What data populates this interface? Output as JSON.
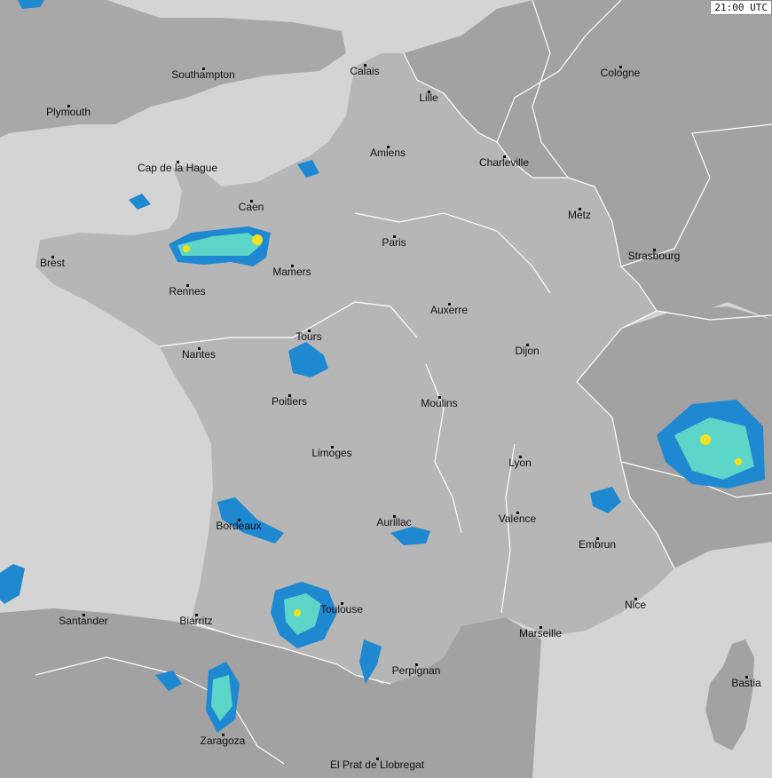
{
  "timestamp": "21:00 UTC",
  "colors": {
    "sea": "#d4d4d4",
    "france": "#b6b6b6",
    "neighbor": "#a2a2a2",
    "uk": "#a8a8a8",
    "border": "#ffffff",
    "rain_low": "#1e88d0",
    "rain_mid": "#5bd6c8",
    "rain_high": "#f5e020"
  },
  "cities": [
    {
      "id": "southampton",
      "name": "Southampton"
    },
    {
      "id": "plymouth",
      "name": "Plymouth"
    },
    {
      "id": "calais",
      "name": "Calais"
    },
    {
      "id": "lille",
      "name": "Lille"
    },
    {
      "id": "cologne",
      "name": "Cologne"
    },
    {
      "id": "amiens",
      "name": "Amiens"
    },
    {
      "id": "charleville",
      "name": "Charleville"
    },
    {
      "id": "cap-de-la-hague",
      "name": "Cap de la Hague"
    },
    {
      "id": "caen",
      "name": "Caen"
    },
    {
      "id": "metz",
      "name": "Metz"
    },
    {
      "id": "paris",
      "name": "Paris"
    },
    {
      "id": "brest",
      "name": "Brest"
    },
    {
      "id": "mamers",
      "name": "Mamers"
    },
    {
      "id": "strasbourg",
      "name": "Strasbourg"
    },
    {
      "id": "rennes",
      "name": "Rennes"
    },
    {
      "id": "auxerre",
      "name": "Auxerre"
    },
    {
      "id": "tours",
      "name": "Tours"
    },
    {
      "id": "nantes",
      "name": "Nantes"
    },
    {
      "id": "dijon",
      "name": "Dijon"
    },
    {
      "id": "poitiers",
      "name": "Poitiers"
    },
    {
      "id": "moulins",
      "name": "Moulins"
    },
    {
      "id": "limoges",
      "name": "Limoges"
    },
    {
      "id": "lyon",
      "name": "Lyon"
    },
    {
      "id": "valence",
      "name": "Valence"
    },
    {
      "id": "aurillac",
      "name": "Aurillac"
    },
    {
      "id": "bordeaux",
      "name": "Bordeaux"
    },
    {
      "id": "embrun",
      "name": "Embrun"
    },
    {
      "id": "nice",
      "name": "Nice"
    },
    {
      "id": "toulouse",
      "name": "Toulouse"
    },
    {
      "id": "santander",
      "name": "Santander"
    },
    {
      "id": "biarritz",
      "name": "Biarritz"
    },
    {
      "id": "marseille",
      "name": "Marseille"
    },
    {
      "id": "perpignan",
      "name": "Perpignan"
    },
    {
      "id": "bastia",
      "name": "Bastia"
    },
    {
      "id": "zaragoza",
      "name": "Zaragoza"
    },
    {
      "id": "el-prat-de-llobregat",
      "name": "El Prat de Llobregat"
    }
  ]
}
